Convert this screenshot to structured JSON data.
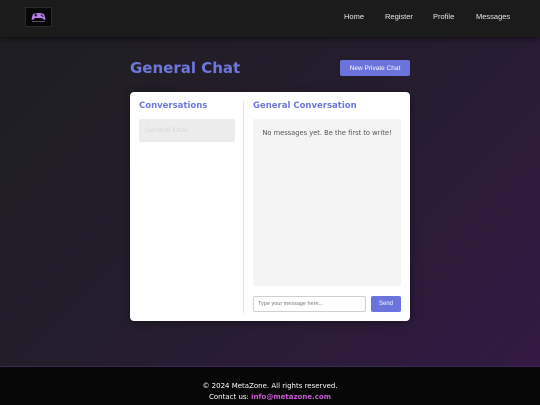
{
  "colors": {
    "accent": "#6e78dc",
    "button": "#6b74dc",
    "navbar": "#1b1b1b",
    "footer": "#070707",
    "footer_link": "#c75ad2"
  },
  "nav": {
    "logo_icon": "gamepad-logo-icon",
    "links": [
      "Home",
      "Register",
      "Profile",
      "Messages"
    ]
  },
  "header": {
    "title": "General Chat",
    "new_chat_button": "New Private Chat"
  },
  "sidebar": {
    "title": "Conversations",
    "items": [
      {
        "label": "General Chat",
        "active": true
      }
    ]
  },
  "conversation": {
    "title": "General Conversation",
    "empty_message": "No messages yet. Be the first to write!",
    "input_placeholder": "Type your message here...",
    "input_value": "",
    "send_label": "Send"
  },
  "footer": {
    "copyright": "© 2024 MetaZone. All rights reserved.",
    "contact_label": "Contact us:",
    "contact_email": "info@metazone.com"
  }
}
